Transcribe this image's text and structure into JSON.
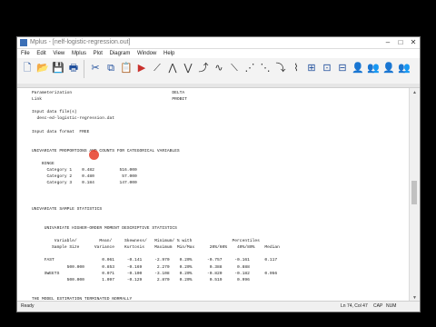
{
  "window": {
    "title": "Mplus - [nelf-logistic-regression.out]"
  },
  "menu": [
    "File",
    "Edit",
    "View",
    "Mplus",
    "Plot",
    "Diagram",
    "Window",
    "Help"
  ],
  "document": {
    "lines": [
      "Parameterization                                        DELTA",
      "Link                                                    PROBIT",
      "",
      "Input data file(s)",
      "  desc-ed-logistic-regression.dat",
      "",
      "Input data format  FREE",
      "",
      "",
      "UNIVARIATE PROPORTIONS AND COUNTS FOR CATEGORICAL VARIABLES",
      "",
      "    BINGE",
      "      Category 1    0.482          516.000",
      "      Category 2    0.480           57.000",
      "      Category 3    0.184          147.000",
      "",
      "",
      "",
      "UNIVARIATE SAMPLE STATISTICS",
      "",
      "",
      "     UNIVARIATE HIGHER-ORDER MOMENT DESCRIPTIVE STATISTICS",
      "",
      "         Variable/         Mean/     Skewness/   Minimum/ % with                Percentiles",
      "        Sample Size      Variance    Kurtosis    Maximum  Min/Max      20%/60%    40%/80%    Median",
      "",
      "     FAST                   0.061     -0.141     -2.970    0.20%      -0.757     -0.161      0.117",
      "              500.000       0.853     -0.169      2.270    0.20%       0.388      0.888",
      "     SWEETS                 0.071     -0.100     -3.108    0.20%      -0.820     -0.182      0.056",
      "              500.000       1.097     -0.129      2.870    0.20%       0.519      0.996",
      "",
      "",
      "THE MODEL ESTIMATION TERMINATED NORMALLY"
    ]
  },
  "status": {
    "left": "Ready",
    "position": "Ln 74, Col 47",
    "caps": "CAP",
    "num": "NUM"
  }
}
